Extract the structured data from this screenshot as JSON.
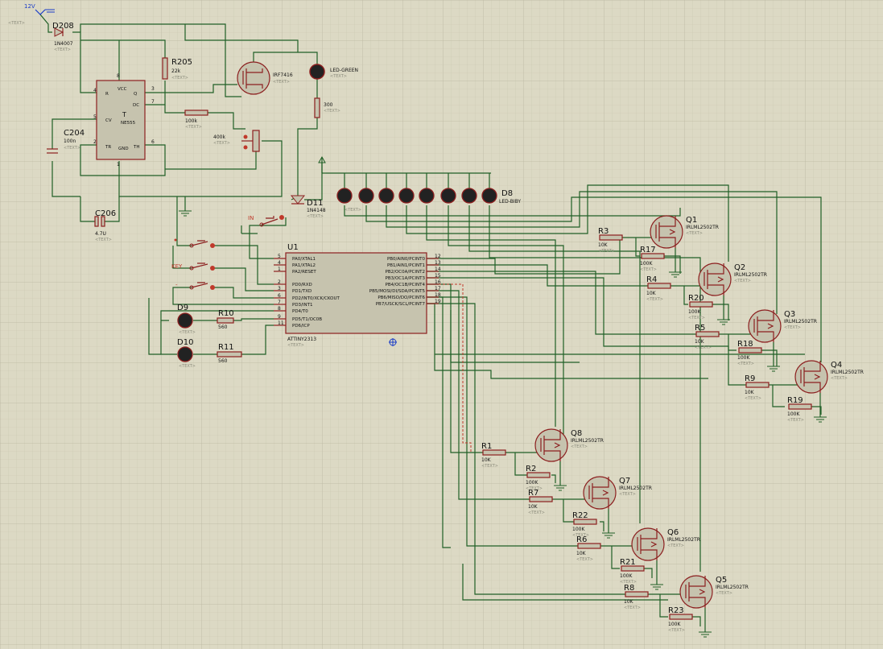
{
  "power": {
    "supply": "12V",
    "text_placeholder": "<TEXT>"
  },
  "placeholder": "<TEXT>",
  "timer": {
    "ref": "T",
    "value": "NE555",
    "pins": [
      {
        "n": "4",
        "name": "R"
      },
      {
        "n": "8",
        "name": "VCC"
      },
      {
        "n": "3",
        "name": "Q"
      },
      {
        "n": "7",
        "name": "DC"
      },
      {
        "n": "5",
        "name": "CV"
      },
      {
        "n": "2",
        "name": "TR"
      },
      {
        "n": "1",
        "name": "GND"
      },
      {
        "n": "6",
        "name": "TH"
      }
    ]
  },
  "mcu": {
    "ref": "U1",
    "value": "ATTINY2313",
    "left_pins": [
      {
        "n": "5",
        "name": "PA0/XTAL1"
      },
      {
        "n": "4",
        "name": "PA1/XTAL2"
      },
      {
        "n": "1",
        "name": "PA2/RESET"
      },
      {
        "n": "2",
        "name": "PD0/RXD"
      },
      {
        "n": "3",
        "name": "PD1/TXD"
      },
      {
        "n": "6",
        "name": "PD2/INT0/XCK/CKOUT"
      },
      {
        "n": "7",
        "name": "PD3/INT1"
      },
      {
        "n": "8",
        "name": "PD4/T0"
      },
      {
        "n": "9",
        "name": "PD5/T1/OC0B"
      },
      {
        "n": "11",
        "name": "PD6/ICP"
      }
    ],
    "right_pins": [
      {
        "n": "12",
        "name": "PB0/AIN0/PCINT0"
      },
      {
        "n": "13",
        "name": "PB1/AIN1/PCINT1"
      },
      {
        "n": "14",
        "name": "PB2/OC0A/PCINT2"
      },
      {
        "n": "15",
        "name": "PB3/OC1A/PCINT3"
      },
      {
        "n": "16",
        "name": "PB4/OC1B/PCINT4"
      },
      {
        "n": "17",
        "name": "PB5/MOSI/DI/SDA/PCINT5"
      },
      {
        "n": "18",
        "name": "PB6/MISO/DO/PCINT6"
      },
      {
        "n": "19",
        "name": "PB7/USCK/SCL/PCINT7"
      }
    ]
  },
  "diodes": {
    "d208": {
      "ref": "D208",
      "value": "1N4007"
    },
    "d11": {
      "ref": "D11",
      "value": "1N4148"
    }
  },
  "mosfet_main": {
    "ref": "",
    "value": "IRF7416"
  },
  "led_green": {
    "value": "LED-GREEN"
  },
  "led_bar": {
    "ref": "D8",
    "value": "LED-BIBY",
    "count": 8
  },
  "passives": {
    "r205": {
      "ref": "R205",
      "value": "22k"
    },
    "r_100k": {
      "ref": "",
      "value": "100k"
    },
    "r_300": {
      "ref": "",
      "value": "300"
    },
    "pot": {
      "value": "400k"
    },
    "c204": {
      "ref": "C204",
      "value": "100n"
    },
    "c206": {
      "ref": "C206",
      "value": "4.7U"
    },
    "r10": {
      "ref": "R10",
      "value": "560"
    },
    "r11": {
      "ref": "R11",
      "value": "560"
    }
  },
  "leds": {
    "d9": "D9",
    "d10": "D10"
  },
  "switches": {
    "in": "IN",
    "key": "KEY",
    "minus": "-"
  },
  "fets": [
    {
      "ref": "Q1",
      "value": "IRLML2502TR"
    },
    {
      "ref": "Q2",
      "value": "IRLML2502TR"
    },
    {
      "ref": "Q3",
      "value": "IRLML2502TR"
    },
    {
      "ref": "Q4",
      "value": "IRLML2502TR"
    },
    {
      "ref": "Q5",
      "value": "IRLML2502TR"
    },
    {
      "ref": "Q6",
      "value": "IRLML2502TR"
    },
    {
      "ref": "Q7",
      "value": "IRLML2502TR"
    },
    {
      "ref": "Q8",
      "value": "IRLML2502TR"
    }
  ],
  "resistors": [
    {
      "ref": "R3",
      "value": "10K"
    },
    {
      "ref": "R17",
      "value": "100K"
    },
    {
      "ref": "R4",
      "value": "10K"
    },
    {
      "ref": "R20",
      "value": "100K"
    },
    {
      "ref": "R5",
      "value": "10K"
    },
    {
      "ref": "R18",
      "value": "100K"
    },
    {
      "ref": "R9",
      "value": "10K"
    },
    {
      "ref": "R19",
      "value": "100K"
    },
    {
      "ref": "R1",
      "value": "10K"
    },
    {
      "ref": "R2",
      "value": "100K"
    },
    {
      "ref": "R7",
      "value": "10K"
    },
    {
      "ref": "R22",
      "value": "100K"
    },
    {
      "ref": "R6",
      "value": "10K"
    },
    {
      "ref": "R21",
      "value": "100K"
    },
    {
      "ref": "R8",
      "value": "10K"
    },
    {
      "ref": "R23",
      "value": "100K"
    }
  ],
  "colors": {
    "background": "#dcd9c4",
    "grid": "#c9c6b0",
    "wire": "#1f5f26",
    "component": "#8c1f1f",
    "body_fill": "#c6c3ae",
    "power": "#1a3cc8"
  }
}
